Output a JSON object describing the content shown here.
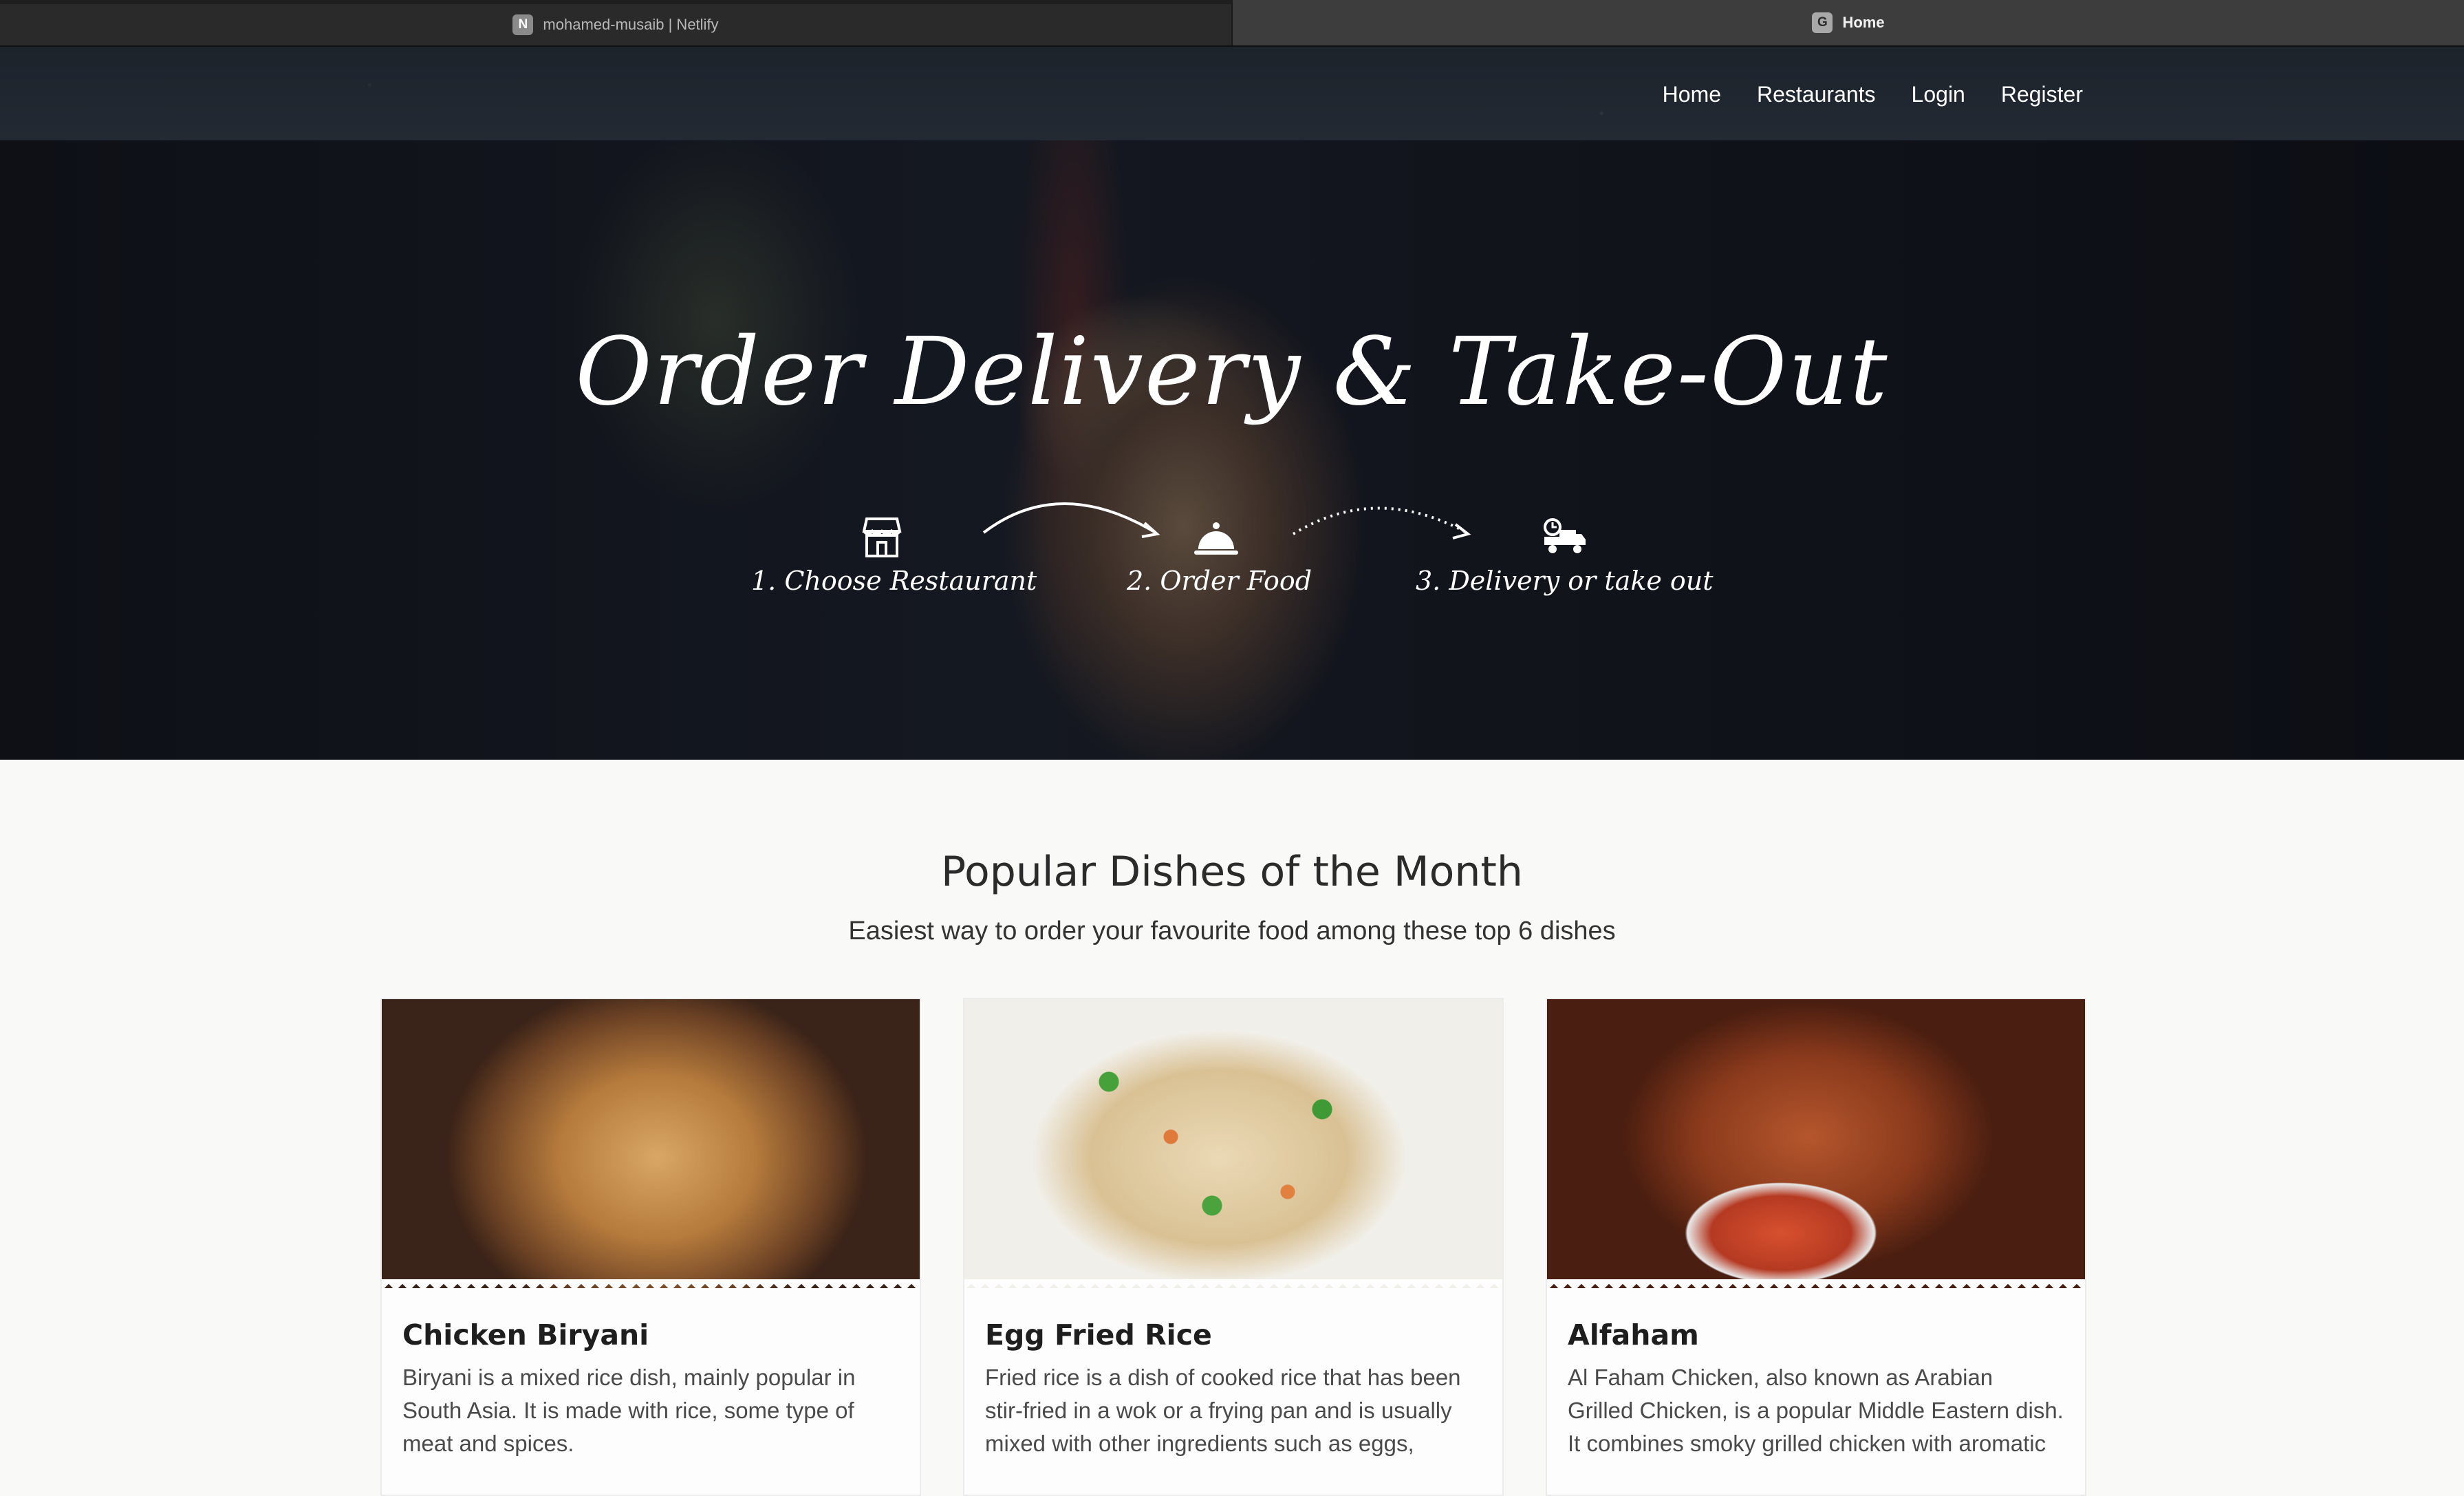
{
  "browser": {
    "tabs": [
      {
        "favicon": "N",
        "title": "mohamed-musaib | Netlify",
        "active": false
      },
      {
        "favicon": "G",
        "title": "Home",
        "active": true
      }
    ]
  },
  "nav": {
    "links": [
      "Home",
      "Restaurants",
      "Login",
      "Register"
    ]
  },
  "hero": {
    "title": "Order Delivery & Take-Out",
    "steps": [
      {
        "icon": "storefront-icon",
        "label": "1. Choose Restaurant"
      },
      {
        "icon": "cloche-icon",
        "label": "2. Order Food"
      },
      {
        "icon": "delivery-truck-icon",
        "label": "3. Delivery or take out"
      }
    ]
  },
  "popular": {
    "title": "Popular Dishes of the Month",
    "subtitle": "Easiest way to order your favourite food among these top 6 dishes",
    "dishes": [
      {
        "name": "Chicken Biryani",
        "description": "Biryani is a mixed rice dish, mainly popular in South Asia. It is made with rice, some type of meat and spices."
      },
      {
        "name": "Egg Fried Rice",
        "description": "Fried rice is a dish of cooked rice that has been stir-fried in a wok or a frying pan and is usually mixed with other ingredients such as eggs,"
      },
      {
        "name": "Alfaham",
        "description": "Al Faham Chicken, also known as Arabian Grilled Chicken, is a popular Middle Eastern dish. It combines smoky grilled chicken with aromatic"
      }
    ]
  },
  "colors": {
    "nav_bg": "#1f262e",
    "hero_bg": "#12141c",
    "page_bg": "#f9f9f8"
  }
}
